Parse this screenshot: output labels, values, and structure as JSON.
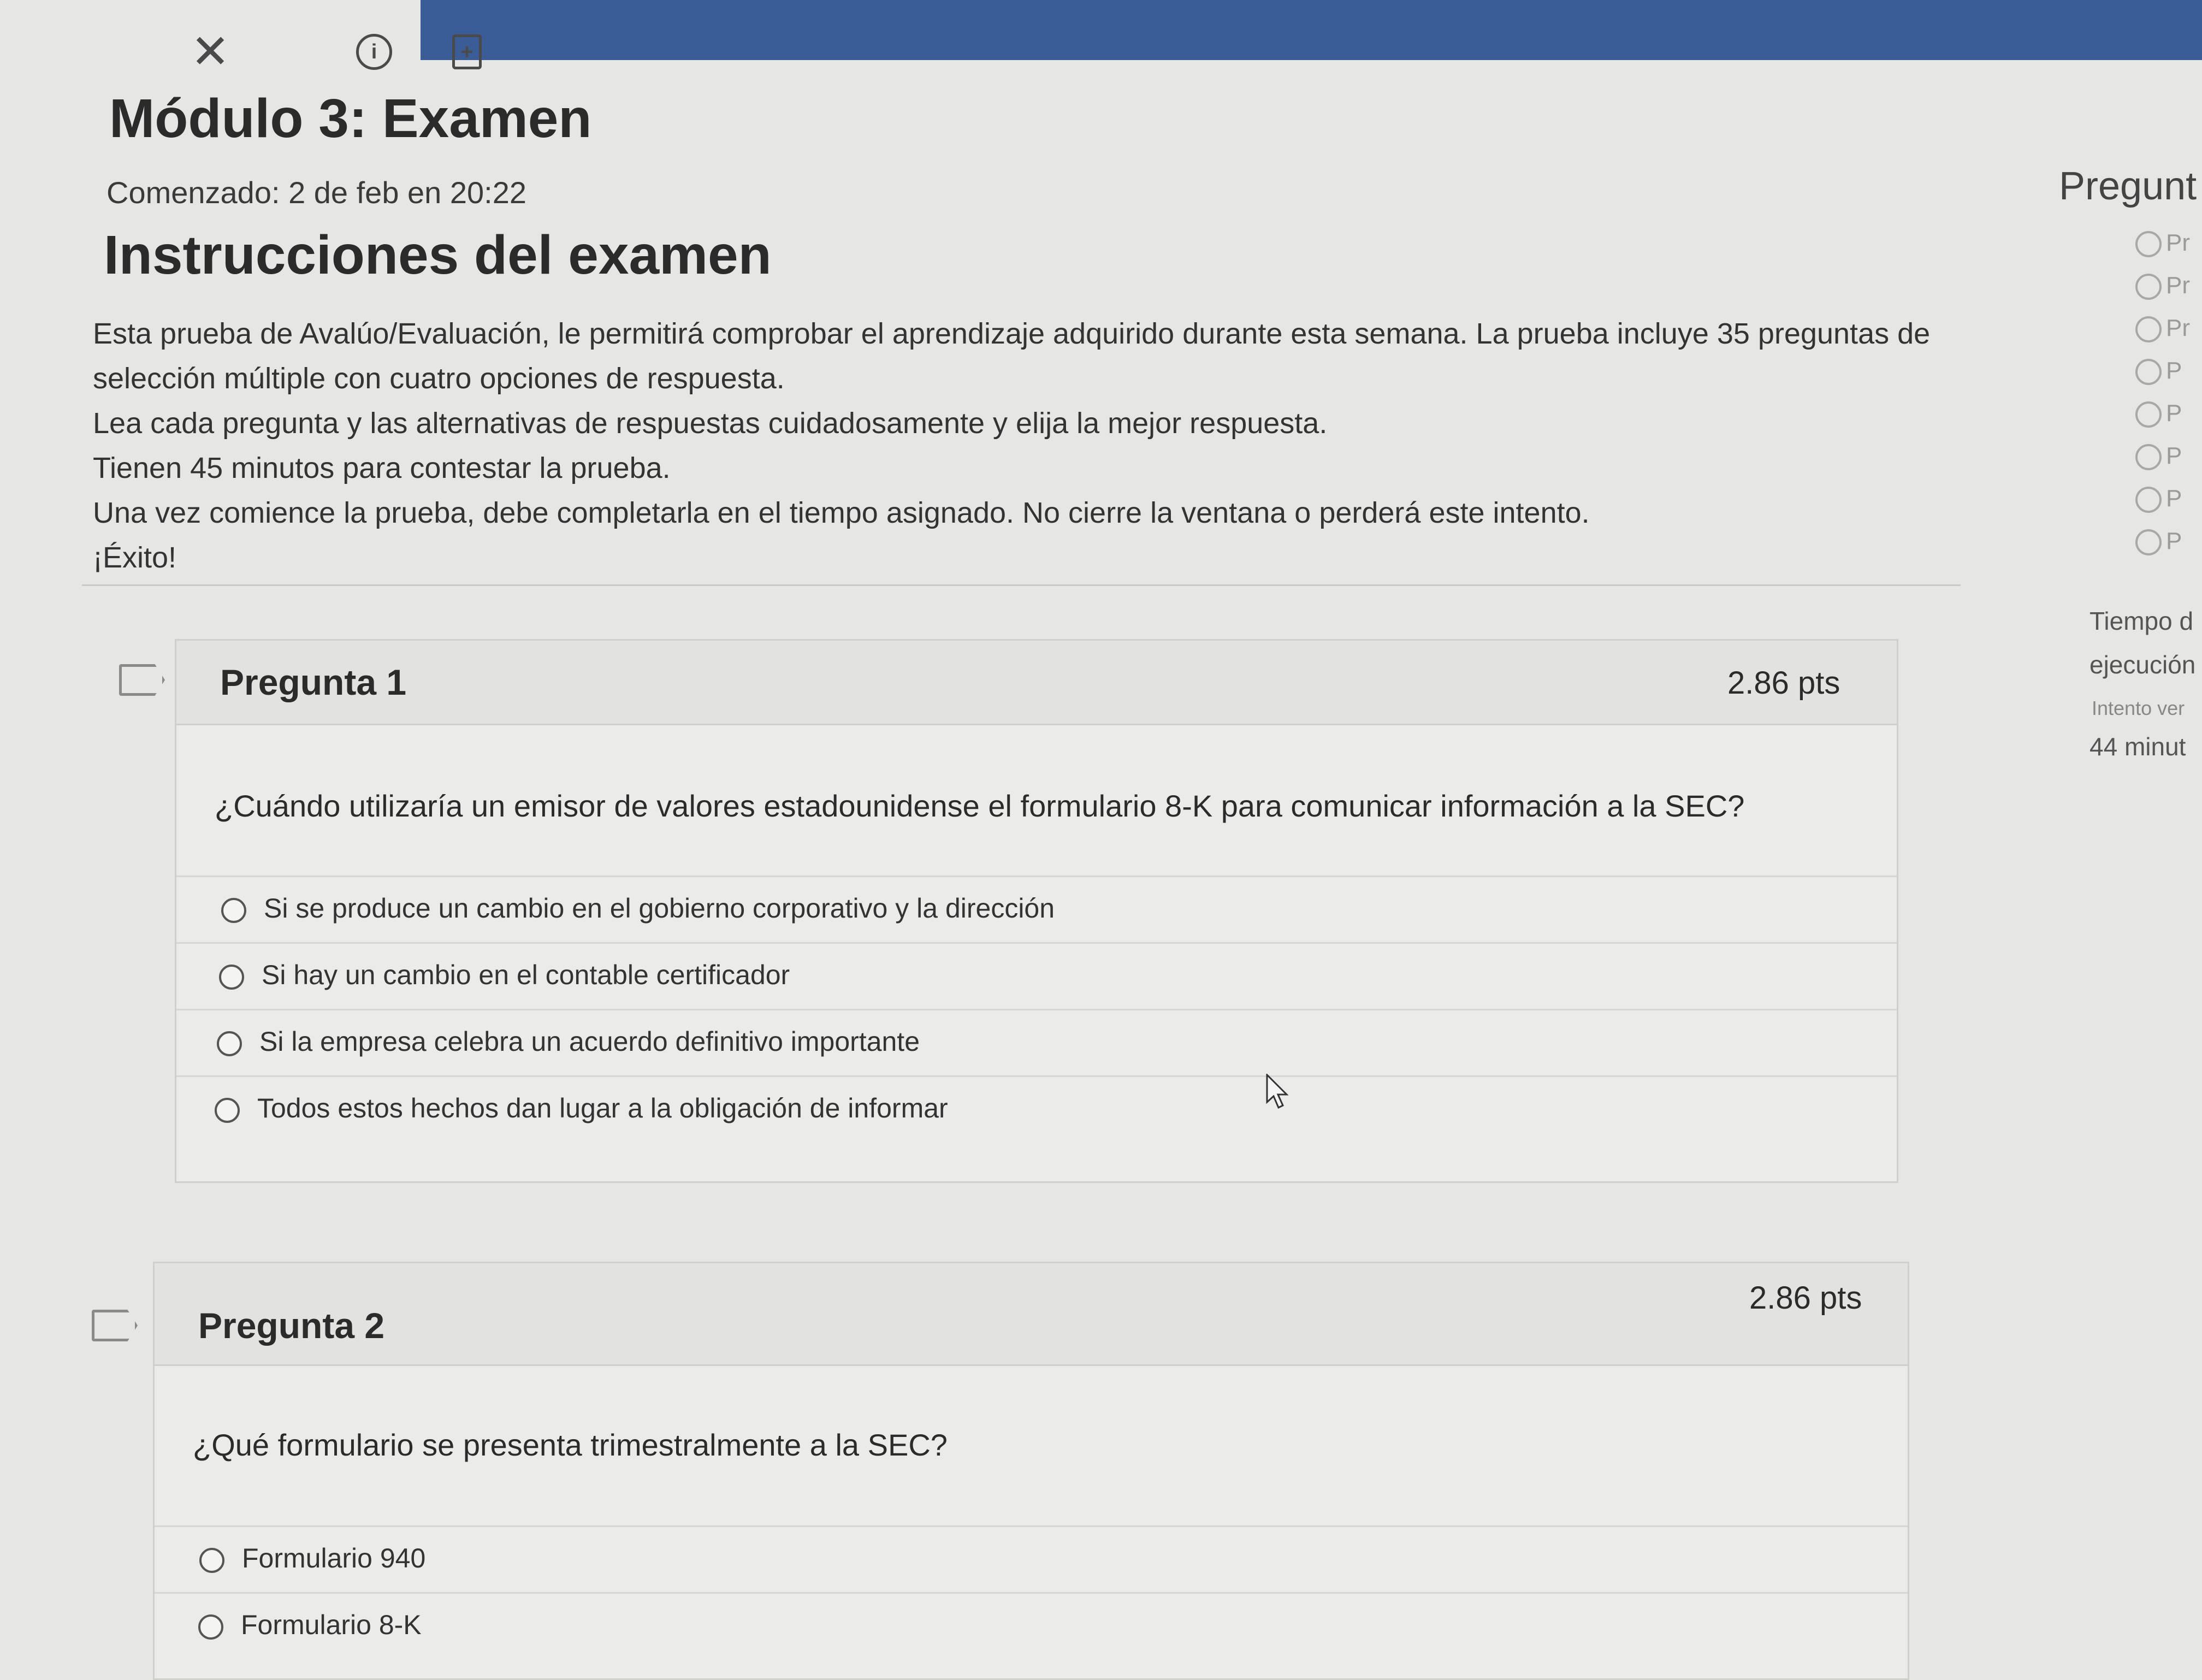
{
  "toolbar": {
    "close_icon": "close-icon",
    "info_icon": "info-icon",
    "add_icon": "add-document-icon",
    "close_glyph": "✕",
    "info_glyph": "i",
    "add_glyph": "+"
  },
  "exam": {
    "title": "Módulo 3: Examen",
    "started": "Comenzado: 2 de feb en 20:22",
    "instructions_title": "Instrucciones del examen",
    "instructions": [
      "Esta prueba de Avalúo/Evaluación, le permitirá comprobar el aprendizaje adquirido durante esta semana. La prueba incluye 35 preguntas de",
      "selección múltiple con cuatro opciones de respuesta.",
      "Lea cada  pregunta y las alternativas de respuestas cuidadosamente y elija la mejor respuesta.",
      "Tienen 45 minutos para contestar la prueba.",
      "Una vez comience la prueba, debe completarla en el tiempo asignado. No cierre la ventana o perderá este intento.",
      "¡Éxito!"
    ]
  },
  "questions": [
    {
      "title": "Pregunta 1",
      "points": "2.86 pts",
      "text": "¿Cuándo utilizaría un emisor de valores estadounidense el formulario 8-K para comunicar información a la SEC?",
      "options": [
        "Si se produce un cambio en el gobierno corporativo y la dirección",
        "Si hay un cambio en el contable certificador",
        "Si la empresa celebra un acuerdo definitivo importante",
        "Todos estos hechos dan lugar a la obligación de informar"
      ]
    },
    {
      "title": "Pregunta 2",
      "points": "2.86 pts",
      "text": "¿Qué formulario se presenta trimestralmente a la SEC?",
      "options": [
        "Formulario 940",
        "Formulario 8-K"
      ]
    }
  ],
  "sidebar": {
    "title": "Pregunt",
    "items": [
      "Pr",
      "Pr",
      "Pr",
      "P",
      "P",
      "P",
      "P",
      "P"
    ],
    "time_label_1": "Tiempo d",
    "time_label_2": "ejecución",
    "attempt_hint": "Intento ver",
    "time_remaining": "44 minut"
  }
}
